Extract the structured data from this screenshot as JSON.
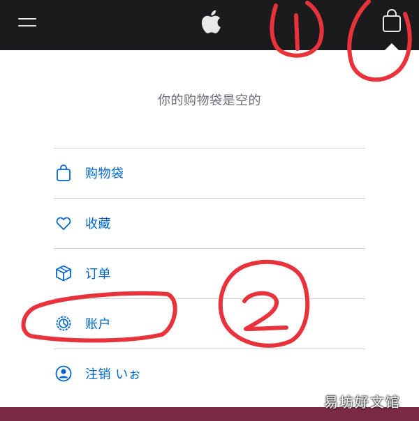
{
  "header": {
    "icons": [
      "menu-icon",
      "apple-logo",
      "shopping-bag-icon"
    ]
  },
  "main": {
    "empty_message": "你的购物袋是空的",
    "menu": [
      {
        "label": "购物袋",
        "icon": "bag-icon"
      },
      {
        "label": "收藏",
        "icon": "heart-icon"
      },
      {
        "label": "订单",
        "icon": "box-icon"
      },
      {
        "label": "账户",
        "icon": "gear-icon"
      },
      {
        "label": "注销 いぉ",
        "icon": "user-icon"
      }
    ]
  },
  "annotations": {
    "mark_1": "①",
    "mark_2": "②",
    "color": "#e8323c"
  },
  "watermark": "易坊好文馆",
  "colors": {
    "header_bg": "#1b1b1d",
    "link": "#0066cc",
    "muted_text": "#6e6e73",
    "divider": "#d2d2d7",
    "footer": "#7b2a45"
  }
}
